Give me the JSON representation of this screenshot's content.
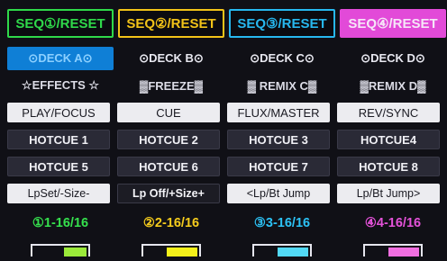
{
  "seq": [
    {
      "label": "SEQ①/RESET",
      "color": "#2fd94a"
    },
    {
      "label": "SEQ②/RESET",
      "color": "#f2c318"
    },
    {
      "label": "SEQ③/RESET",
      "color": "#27b8ef"
    },
    {
      "label": "SEQ④/RESET",
      "color": "#e24ad8"
    }
  ],
  "decks": [
    {
      "label": "⊙DECK A⊙",
      "active": true
    },
    {
      "label": "⊙DECK B⊙",
      "active": false
    },
    {
      "label": "⊙DECK C⊙",
      "active": false
    },
    {
      "label": "⊙DECK D⊙",
      "active": false
    }
  ],
  "fx": [
    "☆EFFECTS ☆",
    "▓FREEZE▓",
    "▓ REMIX C▓",
    "▓REMIX D▓"
  ],
  "mode_buttons": [
    "PLAY/FOCUS",
    "CUE",
    "FLUX/MASTER",
    "REV/SYNC"
  ],
  "hotcues_row1": [
    "HOTCUE 1",
    "HOTCUE 2",
    "HOTCUE 3",
    "HOTCUE4"
  ],
  "hotcues_row2": [
    "HOTCUE 5",
    "HOTCUE 6",
    "HOTCUE 7",
    "HOTCUE 8"
  ],
  "loop_buttons": [
    "LpSet/-Size-",
    "Lp Off/+Size+",
    "<Lp/Bt Jump",
    "Lp/Bt Jump>"
  ],
  "positions": [
    {
      "label": "①1-16/16",
      "color": "#35e14d"
    },
    {
      "label": "②2-16/16",
      "color": "#f5cc1c"
    },
    {
      "label": "③3-16/16",
      "color": "#2cc2f5"
    },
    {
      "label": "④4-16/16",
      "color": "#e452d9"
    }
  ],
  "bar_fills": [
    {
      "color": "#9bea3a",
      "fraction": 0.4
    },
    {
      "color": "#f4f01a",
      "fraction": 0.55
    },
    {
      "color": "#52d9f5",
      "fraction": 0.55
    },
    {
      "color": "#f06ee0",
      "fraction": 0.55
    }
  ]
}
